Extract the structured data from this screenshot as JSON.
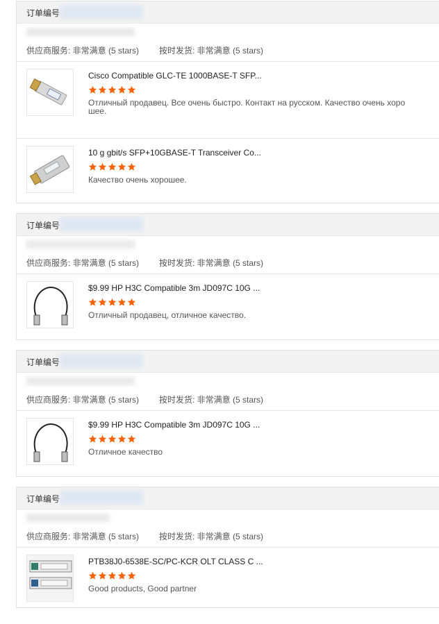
{
  "labels": {
    "order_no": "订单编号",
    "supplier_service": "供应商服务: 非常满意  (5 stars)",
    "on_time_shipping": "按时发货: 非常满意  (5 stars)"
  },
  "colors": {
    "star": "#f5640a",
    "header_bg": "#f2f2f2",
    "border": "#e3e3e3"
  },
  "orders": [
    {
      "items": [
        {
          "title": "Cisco Compatible GLC-TE 1000BASE-T SFP...",
          "rating": 5,
          "review": "Отличный продавец. Все очень быстро. Контакт на русском. Качество очень хоро шее.",
          "image": "sfp-copper-module-icon"
        },
        {
          "title": "10 g gbit/s SFP+10GBASE-T Transceiver Co...",
          "rating": 5,
          "review": "Качество очень хорошее.",
          "image": "sfp-plus-module-icon"
        }
      ]
    },
    {
      "items": [
        {
          "title": "$9.99 HP H3C Compatible 3m JD097C 10G ...",
          "rating": 5,
          "review": "Отличный продавец, отличное качество.",
          "image": "dac-cable-icon"
        }
      ]
    },
    {
      "items": [
        {
          "title": "$9.99 HP H3C Compatible 3m JD097C 10G ...",
          "rating": 5,
          "review": "Отличное качество",
          "image": "dac-cable-icon"
        }
      ]
    },
    {
      "items": [
        {
          "title": "PTB38J0-6538E-SC/PC-KCR OLT CLASS C ...",
          "rating": 5,
          "review": "Good products, Good partner",
          "image": "olt-module-icon"
        }
      ]
    }
  ]
}
